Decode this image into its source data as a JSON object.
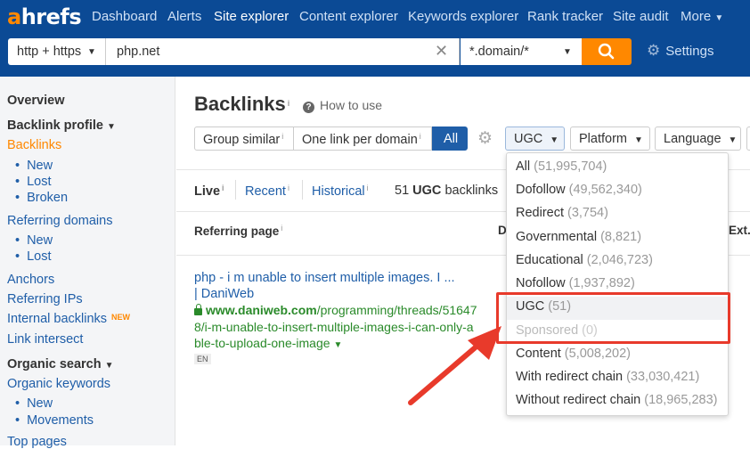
{
  "topnav": {
    "logo_a": "a",
    "logo_rest": "hrefs",
    "items": [
      "Dashboard",
      "Alerts",
      "Site explorer",
      "Content explorer",
      "Keywords explorer",
      "Rank tracker",
      "Site audit",
      "More"
    ],
    "active": "Site explorer"
  },
  "search": {
    "protocol": "http + https",
    "query": "php.net",
    "mode": "*.domain/*",
    "settings_label": "Settings"
  },
  "sidebar": {
    "overview": "Overview",
    "backlink_profile": "Backlink profile",
    "backlinks": "Backlinks",
    "new": "New",
    "lost": "Lost",
    "broken": "Broken",
    "referring_domains": "Referring domains",
    "rd_new": "New",
    "rd_lost": "Lost",
    "anchors": "Anchors",
    "referring_ips": "Referring IPs",
    "internal_backlinks": "Internal backlinks",
    "new_badge": "NEW",
    "link_intersect": "Link intersect",
    "organic_search": "Organic search",
    "organic_keywords": "Organic keywords",
    "ok_new": "New",
    "movements": "Movements",
    "top_pages": "Top pages"
  },
  "main": {
    "title": "Backlinks",
    "how_to": "How to use",
    "filters": {
      "group_similar": "Group similar",
      "one_link": "One link per domain",
      "all": "All",
      "ugc": "UGC",
      "platform": "Platform",
      "language": "Language"
    },
    "tabs": {
      "live": "Live",
      "recent": "Recent",
      "historical": "Historical",
      "count": "51",
      "count_type": "UGC",
      "count_suffix": "backlinks"
    },
    "columns": {
      "referring_page": "Referring page",
      "d": "D",
      "ext": "Ext."
    },
    "row": {
      "title": "php - i m unable to insert multiple images. I ... | DaniWeb",
      "url_domain": "www.daniweb.com",
      "url_path": "/programming/threads/516478/i-m-unable-to-insert-multiple-images-i-can-only-able-to-upload-one-image",
      "lang": "EN"
    }
  },
  "dropdown": {
    "items": [
      {
        "label": "All",
        "count": "(51,995,704)"
      },
      {
        "label": "Dofollow",
        "count": "(49,562,340)"
      },
      {
        "label": "Redirect",
        "count": "(3,754)"
      },
      {
        "label": "Governmental",
        "count": "(8,821)"
      },
      {
        "label": "Educational",
        "count": "(2,046,723)"
      },
      {
        "label": "Nofollow",
        "count": "(1,937,892)"
      },
      {
        "label": "UGC",
        "count": "(51)"
      },
      {
        "label": "Sponsored",
        "count": "(0)"
      },
      {
        "label": "Content",
        "count": "(5,008,202)"
      },
      {
        "label": "With redirect chain",
        "count": "(33,030,421)"
      },
      {
        "label": "Without redirect chain",
        "count": "(18,965,283)"
      }
    ]
  },
  "colors": {
    "nav_bg": "#0b4a95",
    "accent": "#ff8800",
    "link": "#1f5ea8",
    "url_green": "#2a8a2a",
    "highlight_red": "#e83a2b"
  }
}
